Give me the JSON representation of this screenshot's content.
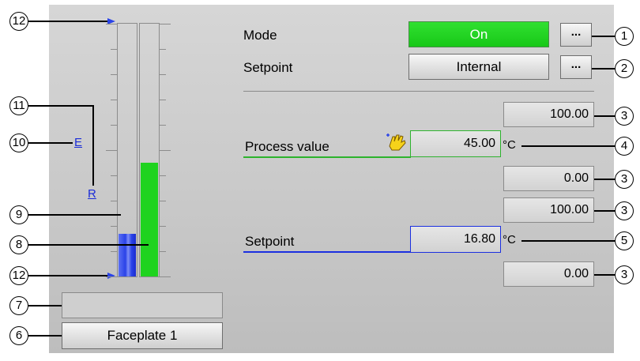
{
  "mode": {
    "label": "Mode",
    "value": "On",
    "more": "..."
  },
  "setpoint_source": {
    "label": "Setpoint",
    "value": "Internal",
    "more": "..."
  },
  "pv": {
    "label": "Process value",
    "high": "100.00",
    "value": "45.00",
    "unit": "°C",
    "low": "0.00"
  },
  "sp": {
    "label": "Setpoint",
    "high": "100.00",
    "value": "16.80",
    "unit": "°C",
    "low": "0.00"
  },
  "bar_graph": {
    "external_marker": "E",
    "internal_marker": "R",
    "pv_fraction": 0.45,
    "sp_fraction": 0.168
  },
  "faceplate": {
    "label": "Faceplate 1",
    "status_text": ""
  },
  "callouts": {
    "c1": "1",
    "c2": "2",
    "c3": "3",
    "c4": "4",
    "c5": "5",
    "c6": "6",
    "c7": "7",
    "c8": "8",
    "c9": "9",
    "c10": "10",
    "c11": "11",
    "c12": "12"
  },
  "colors": {
    "mode_on": "#1fd31f",
    "pv_bar": "#1fd31f",
    "sp_bar": "#2a43e8",
    "pv_underline": "#2db32d",
    "sp_underline": "#1b2fe0"
  }
}
